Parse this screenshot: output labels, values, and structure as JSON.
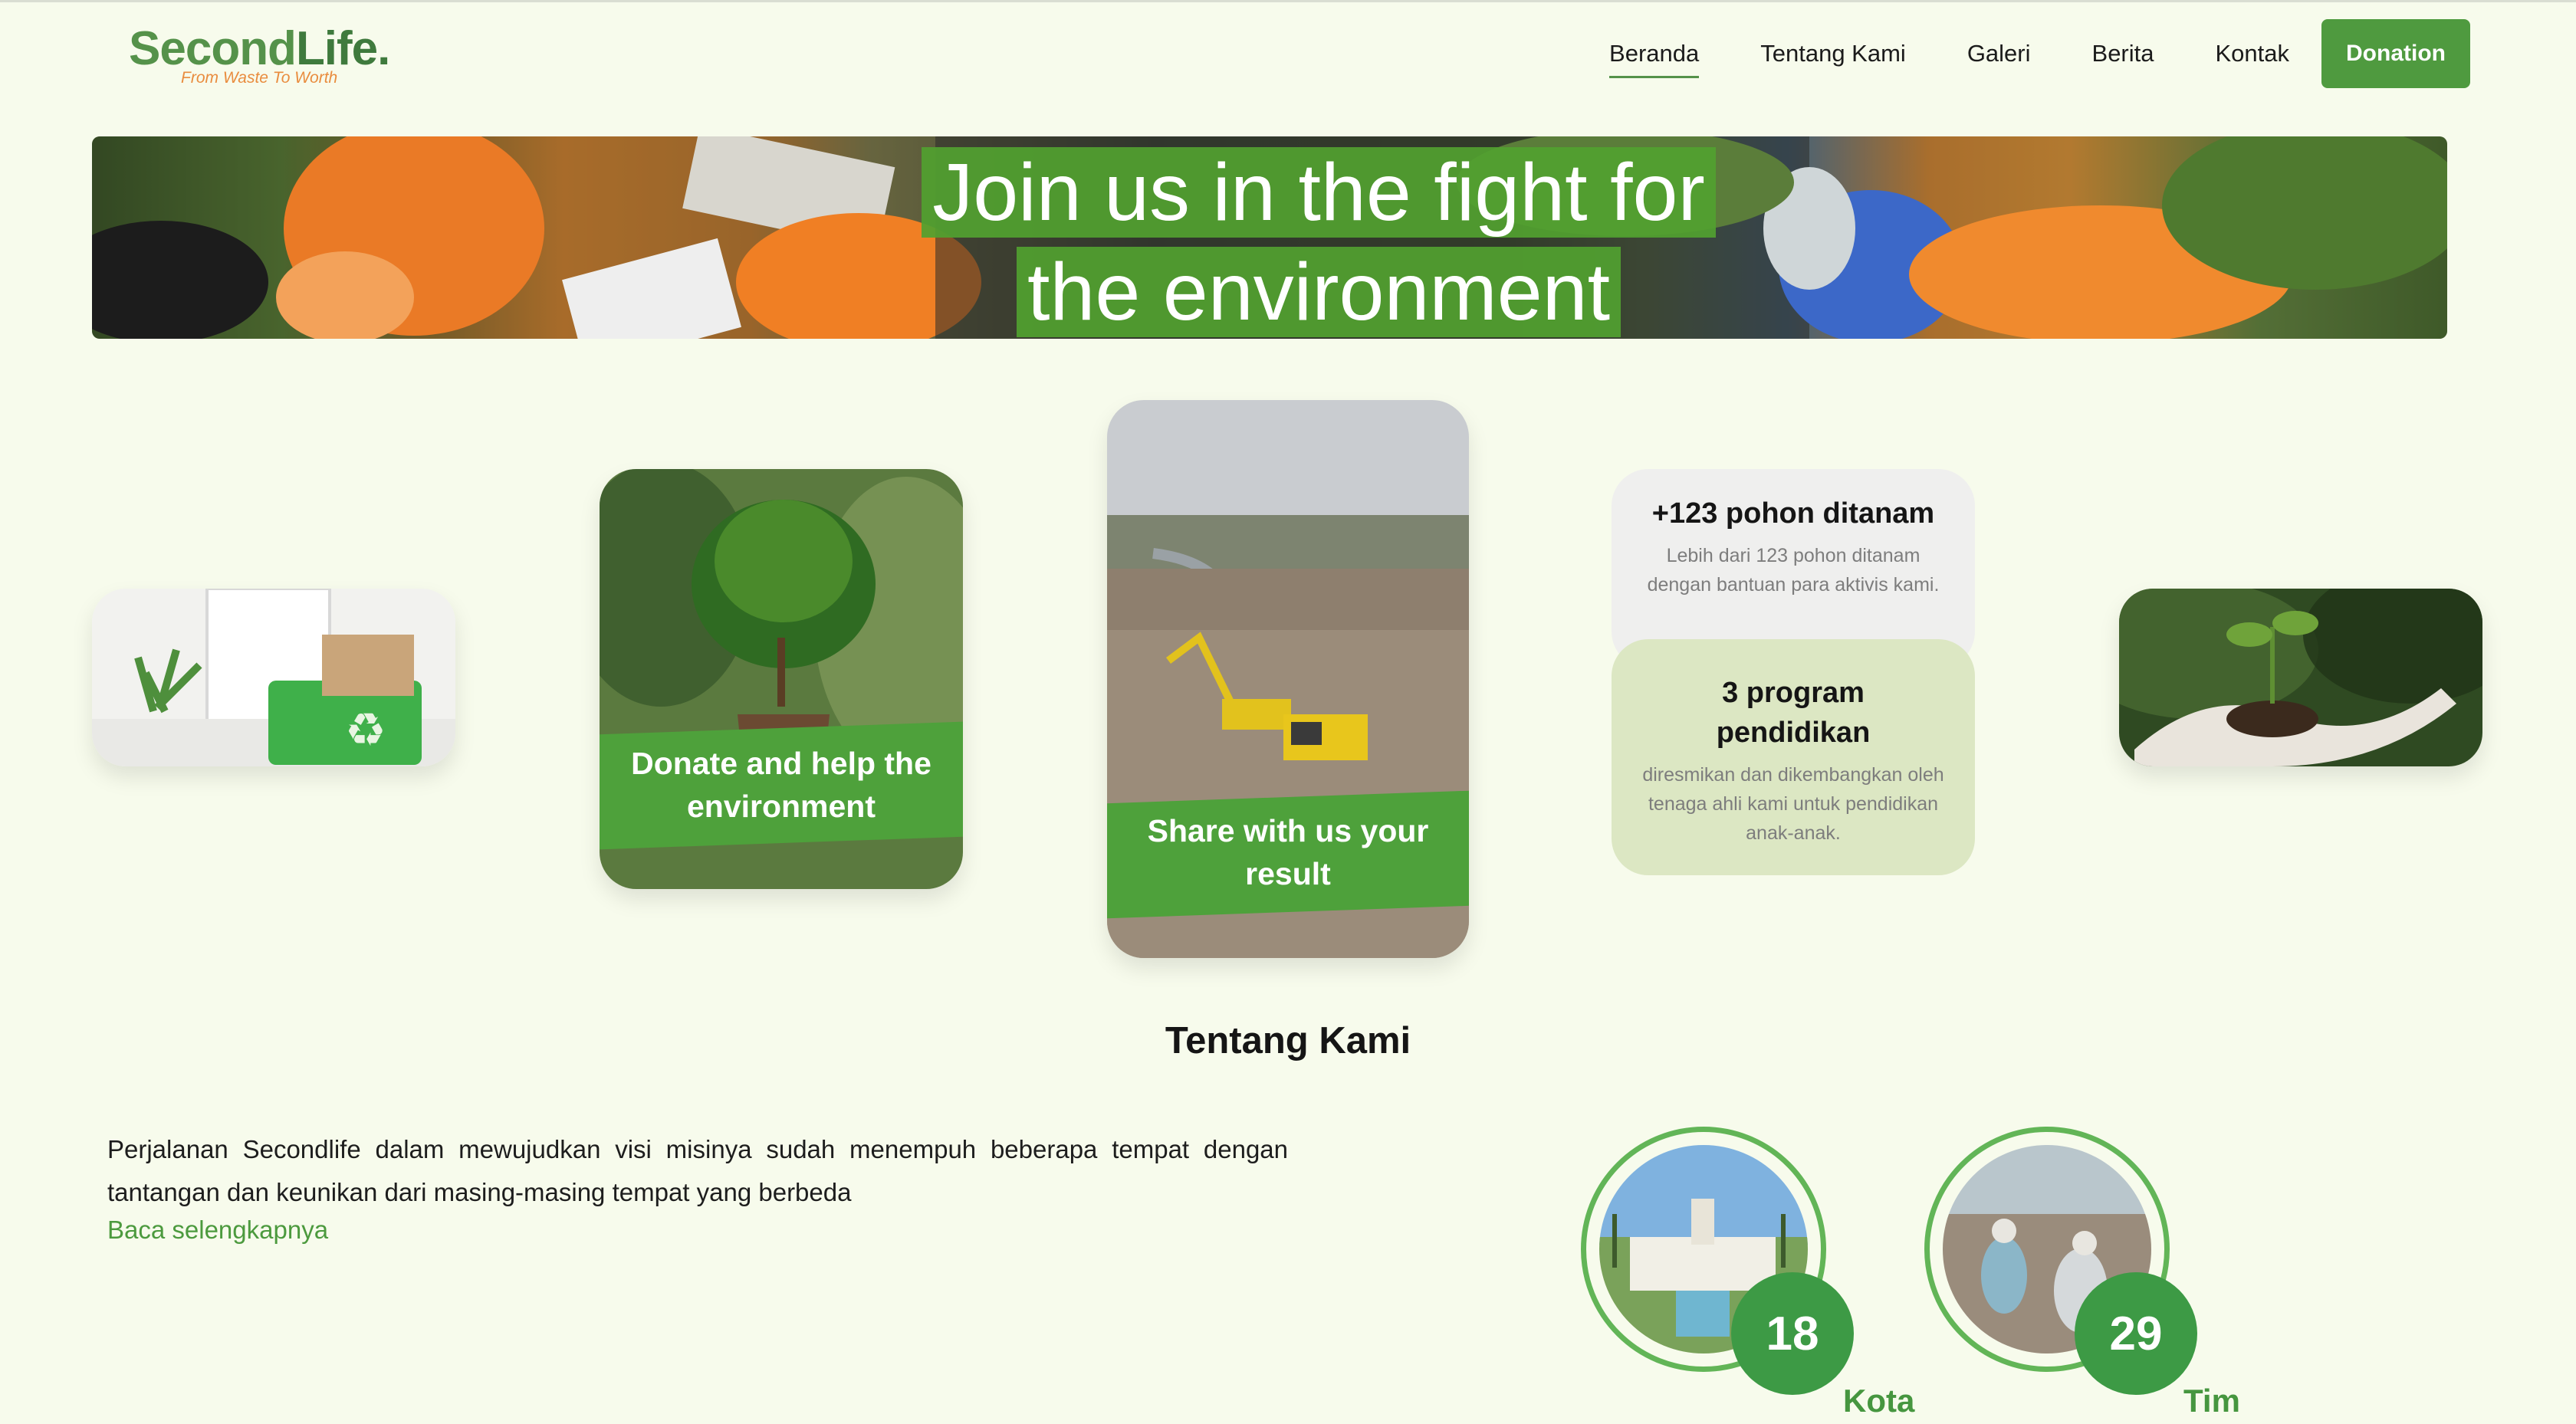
{
  "brand": {
    "name_part1": "Second",
    "name_part2": "Life.",
    "tagline": "From Waste To Worth"
  },
  "nav": {
    "items": [
      {
        "label": "Beranda",
        "active": true
      },
      {
        "label": "Tentang Kami"
      },
      {
        "label": "Galeri"
      },
      {
        "label": "Berita"
      },
      {
        "label": "Kontak"
      }
    ],
    "donation_label": "Donation"
  },
  "hero": {
    "line1": "Join us in the fight for",
    "line2": "the environment"
  },
  "cards": {
    "donate": {
      "label_line1": "Donate and help the",
      "label_line2": "environment"
    },
    "share": {
      "label_line1": "Share with us your",
      "label_line2": "result"
    }
  },
  "stats": {
    "trees": {
      "title": "+123 pohon ditanam",
      "desc": "Lebih dari 123 pohon ditanam dengan bantuan para aktivis kami."
    },
    "programs": {
      "title_line1": "3 program",
      "title_line2": "pendidikan",
      "desc": "diresmikan dan dikembangkan oleh tenaga ahli kami untuk pendidikan anak-anak."
    }
  },
  "about": {
    "title": "Tentang Kami",
    "text": "Perjalanan Secondlife dalam mewujudkan visi misinya sudah menempuh beberapa tempat dengan tantangan dan keunikan dari masing-masing tempat yang berbeda",
    "link": "Baca selengkapnya"
  },
  "metrics": [
    {
      "value": "18",
      "label": "Kota"
    },
    {
      "value": "29",
      "label": "Tim"
    }
  ],
  "colors": {
    "background": "#f7fbec",
    "primary_green": "#4f9a3f",
    "accent_orange": "#e98c3e",
    "card_green": "#dce7c3"
  }
}
